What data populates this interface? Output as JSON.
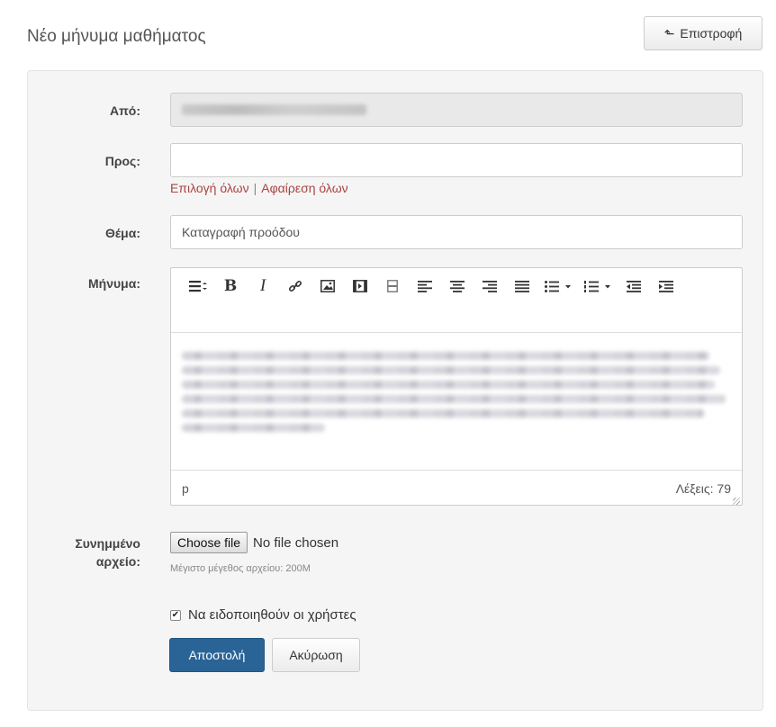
{
  "header": {
    "title": "Νέο μήνυμα μαθήματος",
    "back_label": "Επιστροφή"
  },
  "form": {
    "from": {
      "label": "Από:"
    },
    "to": {
      "label": "Προς:",
      "value": ""
    },
    "recipient_links": {
      "select_all": "Επιλογή όλων",
      "separator": "|",
      "remove_all": "Αφαίρεση όλων"
    },
    "subject": {
      "label": "Θέμα:",
      "value": "Καταγραφή προόδου"
    },
    "message": {
      "label": "Μήνυμα:",
      "toolbar": [
        "format-icon",
        "bold-icon",
        "italic-icon",
        "link-icon",
        "image-icon",
        "media-icon",
        "template-icon",
        "align-left-icon",
        "align-center-icon",
        "align-right-icon",
        "align-justify-icon",
        "bullet-list-icon",
        "numbered-list-icon",
        "outdent-icon",
        "indent-icon"
      ],
      "bold_glyph": "B",
      "italic_glyph": "I",
      "path": "p",
      "word_count": "Λέξεις: 79"
    },
    "attachment": {
      "label_line1": "Συνημμένο",
      "label_line2": "αρχείο:",
      "button_label": "Choose file",
      "status": "No file chosen",
      "hint": "Μέγιστο μέγεθος αρχείου: 200M"
    },
    "notify": {
      "label": "Να ειδοποιηθούν οι χρήστες",
      "checked": true
    },
    "submit_label": "Αποστολή",
    "cancel_label": "Ακύρωση"
  }
}
